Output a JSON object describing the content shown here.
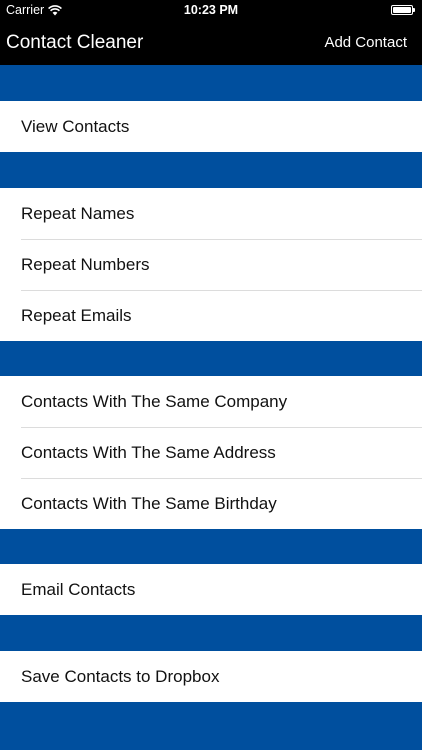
{
  "status_bar": {
    "carrier": "Carrier",
    "wifi_icon": "wifi-icon",
    "time": "10:23 PM",
    "battery_icon": "battery-icon"
  },
  "nav": {
    "title": "Contact Cleaner",
    "action": "Add Contact"
  },
  "sections": [
    {
      "items": [
        {
          "label": "View Contacts"
        }
      ]
    },
    {
      "items": [
        {
          "label": "Repeat Names"
        },
        {
          "label": "Repeat Numbers"
        },
        {
          "label": "Repeat Emails"
        }
      ]
    },
    {
      "items": [
        {
          "label": "Contacts With The Same Company"
        },
        {
          "label": "Contacts With The Same Address"
        },
        {
          "label": "Contacts With The Same Birthday"
        }
      ]
    },
    {
      "items": [
        {
          "label": "Email Contacts"
        }
      ]
    },
    {
      "items": [
        {
          "label": "Save Contacts to Dropbox"
        }
      ]
    }
  ],
  "colors": {
    "background": "#004f9e",
    "nav_bar": "#000000",
    "row_background": "#ffffff"
  }
}
